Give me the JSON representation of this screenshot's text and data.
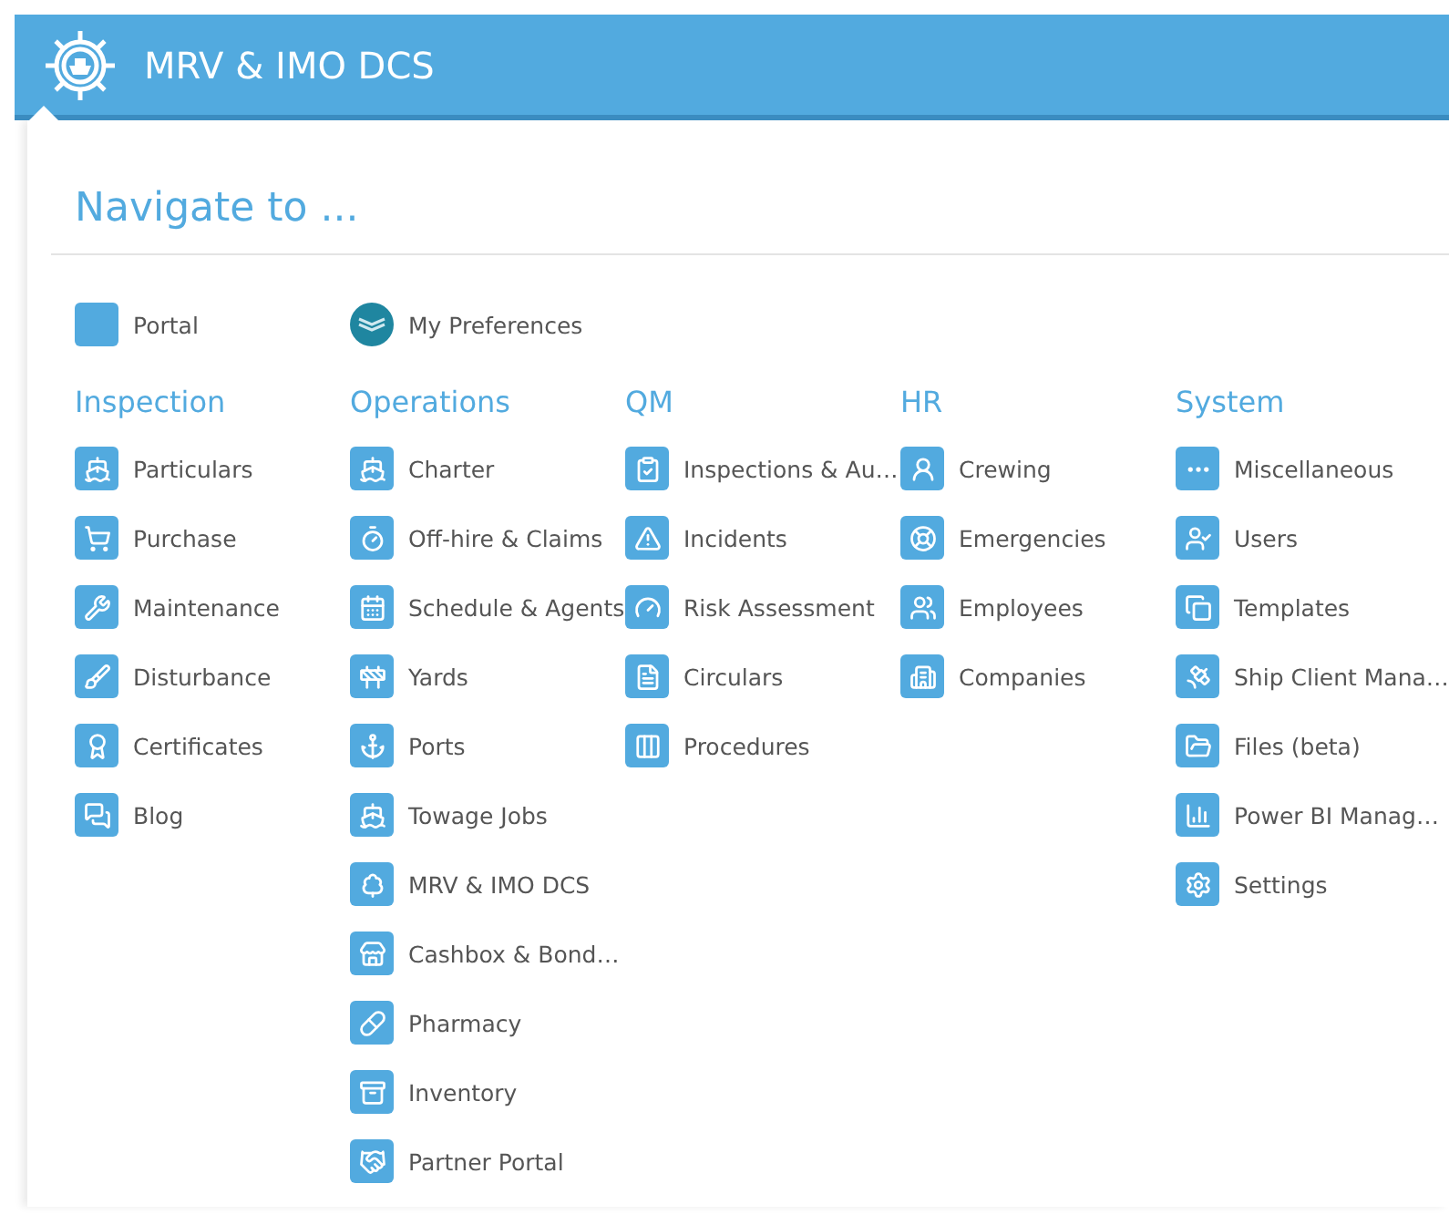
{
  "header": {
    "title": "MRV & IMO DCS"
  },
  "heading": "Navigate to ...",
  "quick_links": [
    {
      "label": "Portal",
      "kind": "blank"
    },
    {
      "label": "My Preferences",
      "kind": "round"
    }
  ],
  "sections": [
    {
      "title": "Inspection",
      "items": [
        "Particulars",
        "Purchase",
        "Maintenance",
        "Disturbance",
        "Certificates",
        "Blog"
      ]
    },
    {
      "title": "Operations",
      "items": [
        "Charter",
        "Off-hire & Claims",
        "Schedule & Agents",
        "Yards",
        "Ports",
        "Towage Jobs",
        "MRV & IMO DCS",
        "Cashbox & Bond…",
        "Pharmacy",
        "Inventory",
        "Partner Portal"
      ]
    },
    {
      "title": "QM",
      "items": [
        "Inspections & Au…",
        "Incidents",
        "Risk Assessment",
        "Circulars",
        "Procedures"
      ]
    },
    {
      "title": "HR",
      "items": [
        "Crewing",
        "Emergencies",
        "Employees",
        "Companies"
      ]
    },
    {
      "title": "System",
      "items": [
        "Miscellaneous",
        "Users",
        "Templates",
        "Ship Client Mana…",
        "Files (beta)",
        "Power BI Manag…",
        "Settings"
      ]
    }
  ]
}
